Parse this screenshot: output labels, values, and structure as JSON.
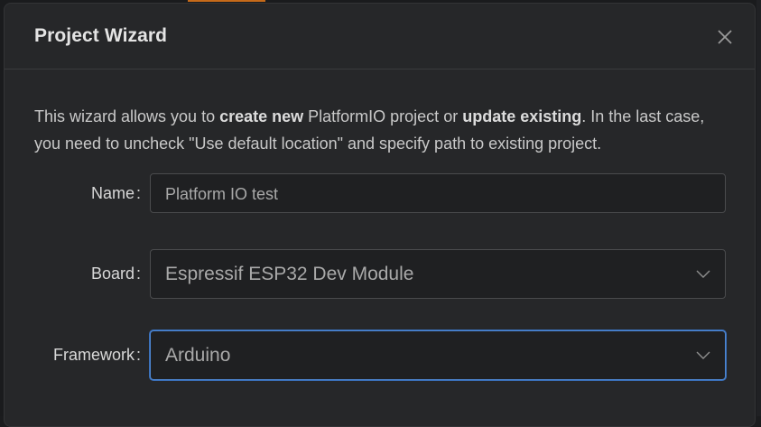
{
  "dialog": {
    "title": "Project Wizard",
    "close_icon": "close-icon",
    "description": {
      "part1": "This wizard allows you to ",
      "bold1": "create new",
      "part2": " PlatformIO project or ",
      "bold2": "update existing",
      "part3": ". In the last case, you need to uncheck \"Use default location\" and specify path to existing project."
    }
  },
  "form": {
    "name": {
      "label": "Name",
      "separator": ":",
      "value": "Platform IO test"
    },
    "board": {
      "label": "Board",
      "separator": ":",
      "selected": "Espressif ESP32 Dev Module",
      "icon": "chevron-down-icon"
    },
    "framework": {
      "label": "Framework",
      "separator": ":",
      "selected": "Arduino",
      "icon": "chevron-down-icon"
    }
  },
  "colors": {
    "dialog_bg": "#262729",
    "focus_border": "#4d86d2",
    "accent": "#c56a1a"
  }
}
